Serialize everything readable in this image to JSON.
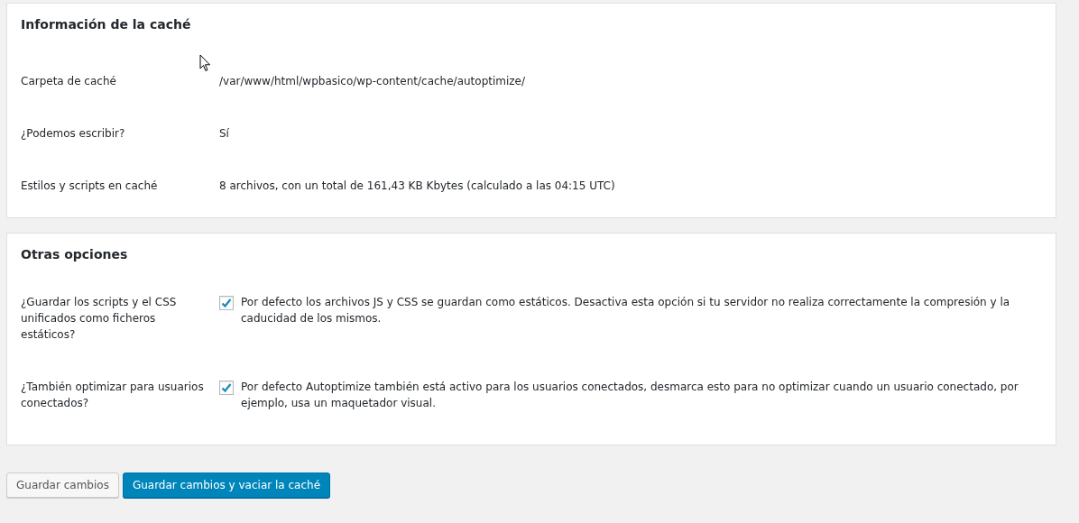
{
  "cache_info": {
    "title": "Información de la caché",
    "rows": [
      {
        "label": "Carpeta de caché",
        "value": "/var/www/html/wpbasico/wp-content/cache/autoptimize/"
      },
      {
        "label": "¿Podemos escribir?",
        "value": "Sí"
      },
      {
        "label": "Estilos y scripts en caché",
        "value": "8 archivos, con un total de 161,43 KB Kbytes (calculado a las 04:15 UTC)"
      }
    ]
  },
  "other_options": {
    "title": "Otras opciones",
    "options": [
      {
        "label": "¿Guardar los scripts y el CSS unificados como ficheros estáticos?",
        "checked": true,
        "description": "Por defecto los archivos JS y CSS se guardan como estáticos. Desactiva esta opción si tu servidor no realiza correctamente la compresión y la caducidad de los mismos."
      },
      {
        "label": "¿También optimizar para usuarios conectados?",
        "checked": true,
        "description": "Por defecto Autoptimize también está activo para los usuarios conectados, desmarca esto para no optimizar cuando un usuario conectado, por ejemplo, usa un maquetador visual."
      }
    ]
  },
  "buttons": [
    {
      "label": "Guardar cambios",
      "kind": "secondary"
    },
    {
      "label": "Guardar cambios y vaciar la caché",
      "kind": "primary"
    }
  ]
}
